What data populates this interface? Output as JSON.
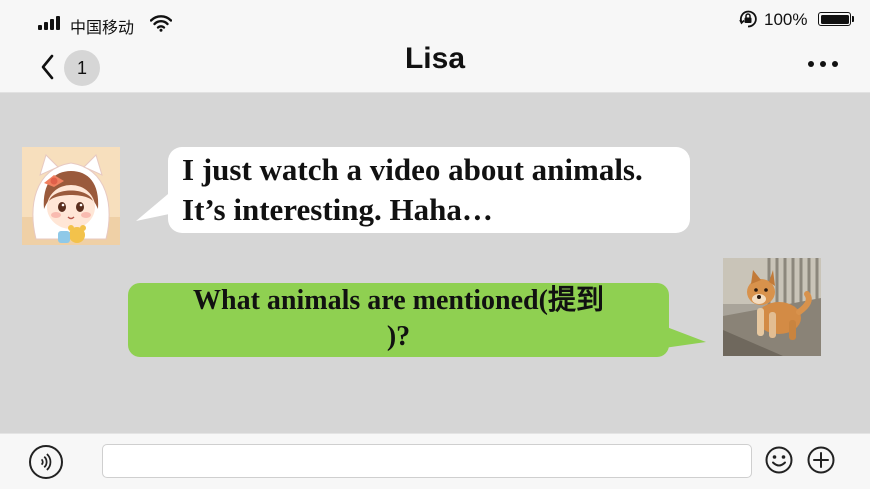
{
  "status_bar": {
    "carrier": "中国移动",
    "battery_percent": "100%",
    "battery_level": 1.0,
    "icons": [
      "signal-icon",
      "wifi-icon",
      "rotation-lock-icon",
      "battery-icon"
    ]
  },
  "nav": {
    "title": "Lisa",
    "unread_count": "1",
    "back_icon": "chevron-left-icon",
    "more_icon": "more-dots-icon"
  },
  "messages": [
    {
      "sender": "Lisa",
      "direction": "incoming",
      "lines": [
        "I just watch a video about animals.",
        "It’s interesting. Haha…"
      ],
      "bubble_color": "#ffffff"
    },
    {
      "sender": "me",
      "direction": "outgoing",
      "lines": [
        "What animals are mentioned(提到",
        ")?"
      ],
      "bubble_color": "#8fd051"
    }
  ],
  "input_bar": {
    "placeholder": "",
    "icons": [
      "voice-icon",
      "emoji-icon",
      "plus-icon"
    ]
  },
  "colors": {
    "chat_background": "#d6d6d6",
    "bar_background": "#f7f7f7",
    "outgoing_bubble": "#8fd051",
    "incoming_bubble": "#ffffff"
  }
}
